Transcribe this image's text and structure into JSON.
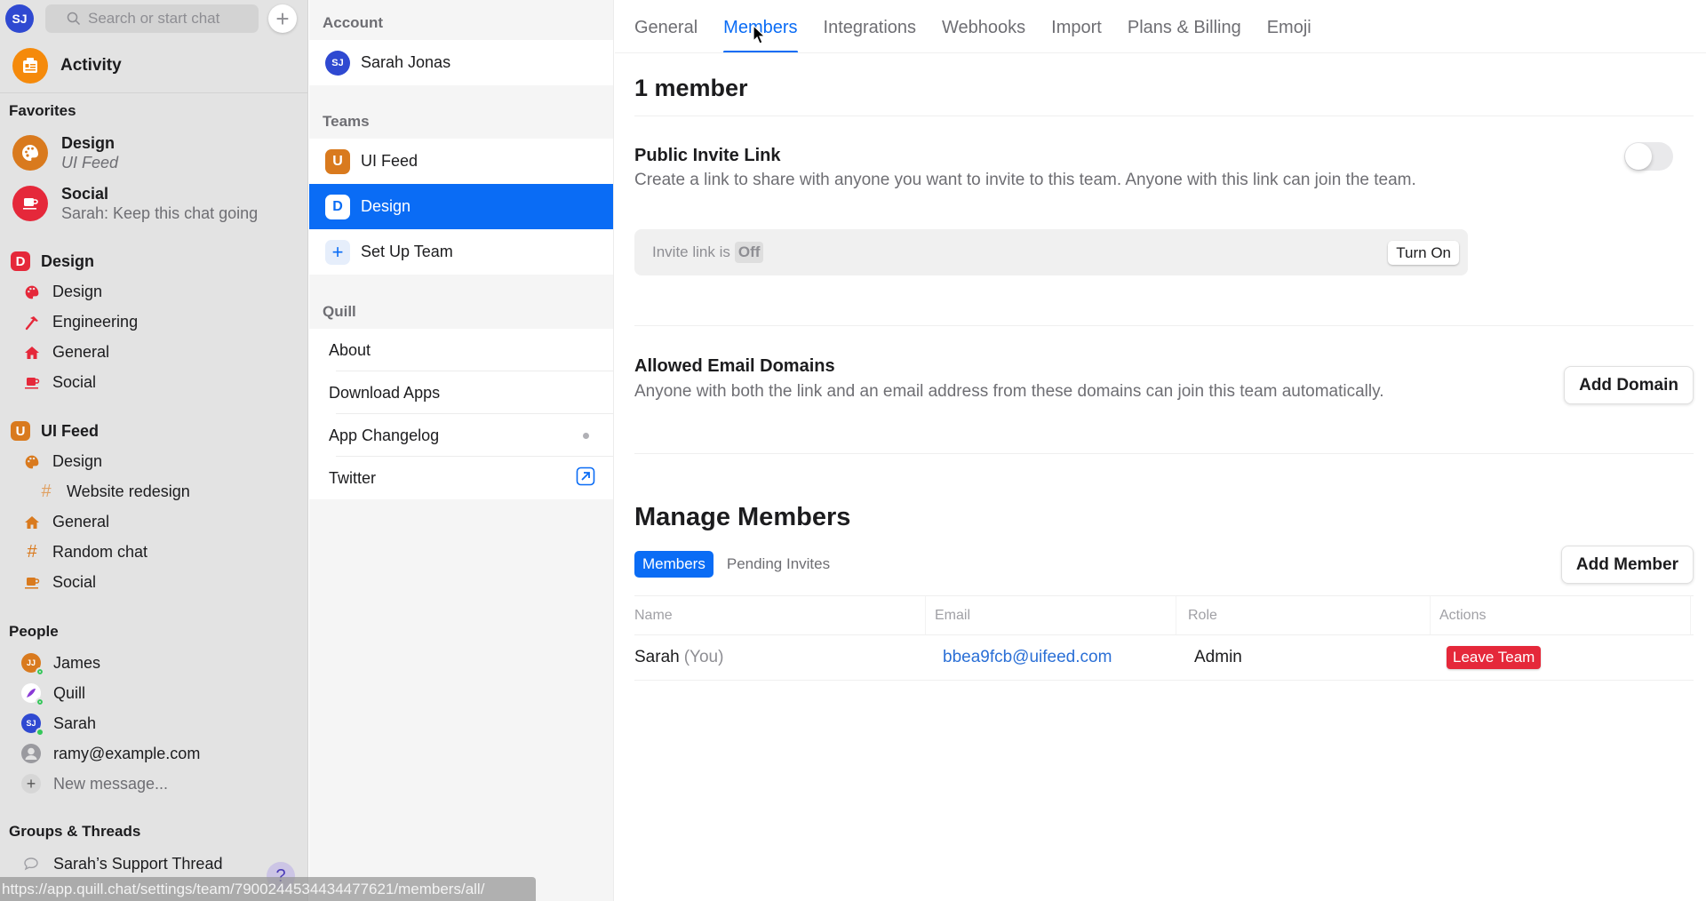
{
  "sidebar": {
    "user_initials": "SJ",
    "search_placeholder": "Search or start chat",
    "activity_label": "Activity",
    "favorites_title": "Favorites",
    "favorites": [
      {
        "title": "Design",
        "subtitle": "UI Feed",
        "icon": "palette-icon",
        "color": "#d97a1e"
      },
      {
        "title": "Social",
        "subtitle": "Sarah: Keep this chat going",
        "icon": "coffee-cup-icon",
        "color": "#e5283a"
      }
    ],
    "teams": [
      {
        "name": "Design",
        "badge": "D",
        "color": "#e5283a",
        "channels": [
          {
            "name": "Design",
            "icon": "palette-icon"
          },
          {
            "name": "Engineering",
            "icon": "hammer-icon"
          },
          {
            "name": "General",
            "icon": "home-icon"
          },
          {
            "name": "Social",
            "icon": "coffee-cup-icon"
          }
        ]
      },
      {
        "name": "UI Feed",
        "badge": "U",
        "color": "#d97a1e",
        "channels": [
          {
            "name": "Design",
            "icon": "palette-icon"
          },
          {
            "name": "Website redesign",
            "icon": "hash-icon",
            "sub": true
          },
          {
            "name": "General",
            "icon": "home-icon"
          },
          {
            "name": "Random chat",
            "icon": "hash-icon"
          },
          {
            "name": "Social",
            "icon": "coffee-cup-icon"
          }
        ]
      }
    ],
    "people_title": "People",
    "people": [
      {
        "name": "James",
        "initials": "JJ",
        "color": "#d97a1e",
        "presence": "away"
      },
      {
        "name": "Quill",
        "initials": "",
        "color": "#ffffff",
        "presence": "away"
      },
      {
        "name": "Sarah",
        "initials": "SJ",
        "color": "#2f49d1",
        "presence": "online"
      },
      {
        "name": "ramy@example.com",
        "initials": "",
        "color": "#8e8e93",
        "presence": "none"
      }
    ],
    "new_message_label": "New message...",
    "groups_title": "Groups & Threads",
    "groups": [
      {
        "name": "Sarah’s Support Thread",
        "icon": "speech-bubble-icon"
      }
    ],
    "help_label": "?"
  },
  "status_bar_url": "https://app.quill.chat/settings/team/7900244534434477621/members/all/",
  "settings_nav": {
    "account_title": "Account",
    "account_name": "Sarah Jonas",
    "account_initials": "SJ",
    "teams_title": "Teams",
    "teams": [
      {
        "name": "UI Feed",
        "badge": "U",
        "color": "#d97a1e",
        "selected": false
      },
      {
        "name": "Design",
        "badge": "D",
        "color": "#0a6cf5",
        "selected": true
      }
    ],
    "setup_team_label": "Set Up Team",
    "quill_title": "Quill",
    "quill_items": [
      {
        "label": "About"
      },
      {
        "label": "Download Apps"
      },
      {
        "label": "App Changelog",
        "indicator": "dot"
      },
      {
        "label": "Twitter",
        "indicator": "external-link-icon"
      }
    ]
  },
  "main": {
    "tabs": [
      {
        "label": "General",
        "active": false
      },
      {
        "label": "Members",
        "active": true
      },
      {
        "label": "Integrations",
        "active": false
      },
      {
        "label": "Webhooks",
        "active": false
      },
      {
        "label": "Import",
        "active": false
      },
      {
        "label": "Plans & Billing",
        "active": false
      },
      {
        "label": "Emoji",
        "active": false
      }
    ],
    "member_count_title": "1 member",
    "invite": {
      "title": "Public Invite Link",
      "description": "Create a link to share with anyone you want to invite to this team. Anyone with this link can join the team.",
      "toggle_on": false,
      "status_prefix": "Invite link is",
      "status_value": "Off",
      "turn_on_label": "Turn On"
    },
    "domains": {
      "title": "Allowed Email Domains",
      "description": "Anyone with both the link and an email address from these domains can join this team automatically.",
      "add_label": "Add Domain"
    },
    "manage": {
      "title": "Manage Members",
      "segments": [
        {
          "label": "Members",
          "active": true
        },
        {
          "label": "Pending Invites",
          "active": false
        }
      ],
      "add_member_label": "Add Member",
      "columns": [
        "Name",
        "Email",
        "Role",
        "Actions"
      ],
      "rows": [
        {
          "name": "Sarah",
          "name_suffix": "(You)",
          "email": "bbea9fcb@uifeed.com",
          "role": "Admin",
          "action": "Leave Team"
        }
      ]
    }
  },
  "colors": {
    "accent": "#0a6cf5",
    "danger": "#e5283a",
    "design_team": "#e5283a",
    "uifeed_team": "#d97a1e",
    "activity": "#f58a0b"
  }
}
